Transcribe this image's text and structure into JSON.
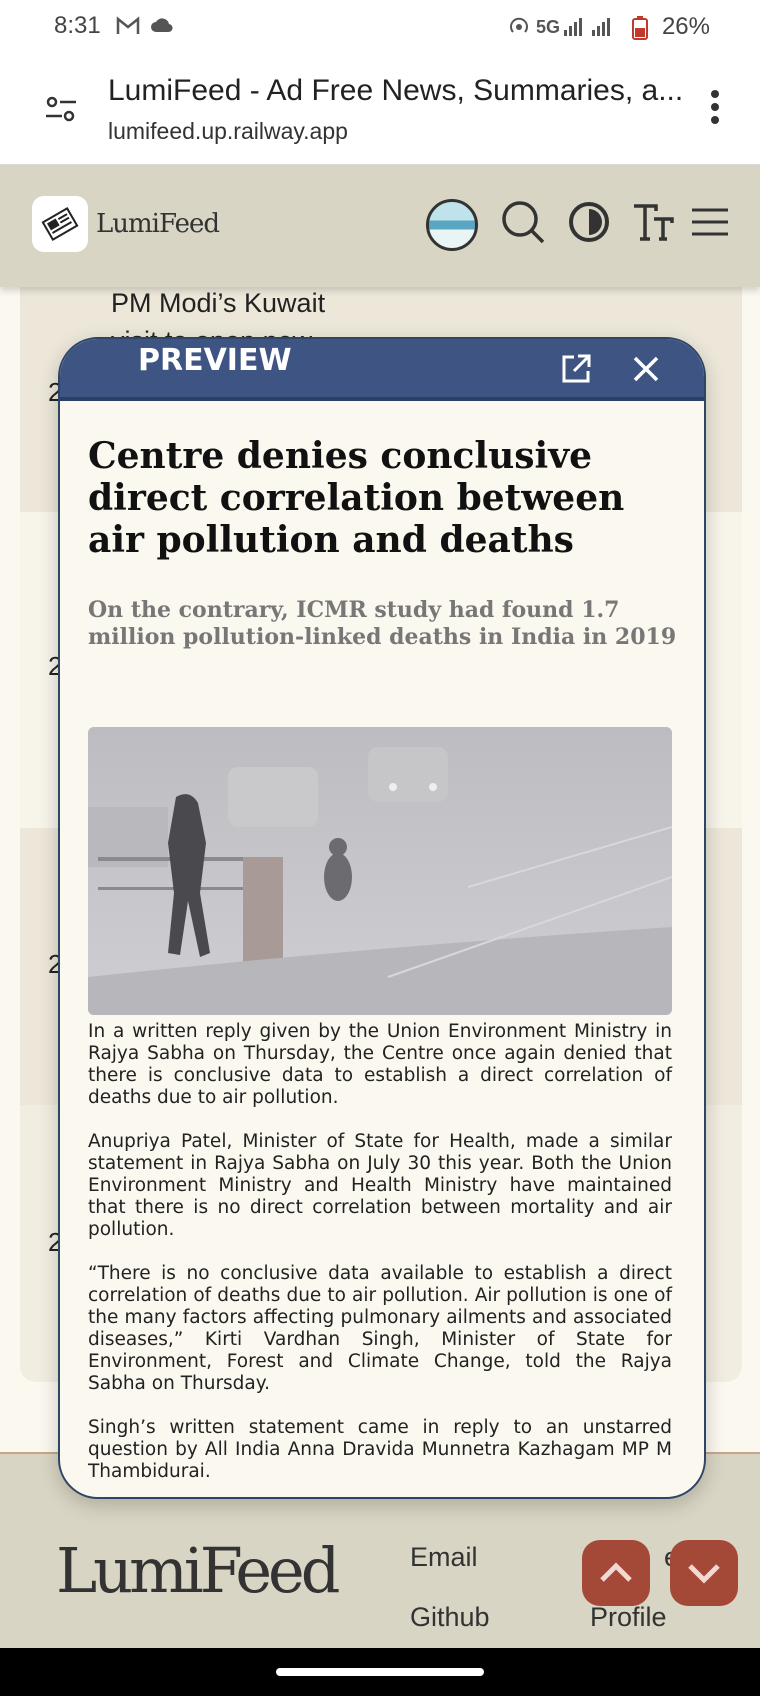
{
  "status_bar": {
    "time": "8:31",
    "network": "5G",
    "battery": "26%",
    "icons": [
      "gmail-icon",
      "cloud-icon",
      "hotspot-icon",
      "signal-icon",
      "battery-icon"
    ]
  },
  "browser": {
    "page_title": "LumiFeed - Ad Free News, Summaries, a...",
    "url": "lumifeed.up.railway.app"
  },
  "site_header": {
    "logo_text": "LumiFeed",
    "icons": [
      "user-avatar",
      "search-icon",
      "theme-toggle-icon",
      "text-size-icon",
      "hamburger-menu-icon"
    ]
  },
  "background_list": {
    "partial_headline": "PM Modi’s Kuwait visit to open new",
    "row_numbers": [
      "2",
      "2",
      "2",
      "2"
    ]
  },
  "preview": {
    "label": "PREVIEW",
    "title": "Centre denies conclusive direct correlation between air pollution and deaths",
    "subtitle": "On the contrary, ICMR study had found 1.7 million pollution-linked deaths in India in 2019",
    "paragraphs": [
      "In a written reply given by the Union Environment Ministry in Rajya Sabha on Thursday, the Centre once again denied that there is conclusive data to establish a direct correlation of deaths due to air pollution.",
      "Anupriya Patel, Minister of State for Health, made a similar statement in Rajya Sabha on July 30 this year. Both the Union Environment Ministry and Health Ministry have maintained that there is no direct correlation between mortality and air pollution.",
      "“There is no conclusive data available to establish a direct correlation of deaths due to air pollution. Air pollution is one of the many factors affecting pulmonary ailments and associated diseases,” Kirti Vardhan Singh, Minister of State for Environment, Forest and Climate Change, told the Rajya Sabha on Thursday.",
      "Singh’s written statement came in reply to an unstarred question by All India Anna Dravida Munnetra Kazhagam MP M Thambidurai."
    ]
  },
  "footer": {
    "logo": "LumiFeed",
    "links": [
      "Email",
      "Github",
      "Profile"
    ],
    "partial_link_text": "e"
  },
  "colors": {
    "accent_header": "#3e5583",
    "background": "#fbf8ef",
    "site_header": "#d9d5c4",
    "fab": "#a44838"
  }
}
